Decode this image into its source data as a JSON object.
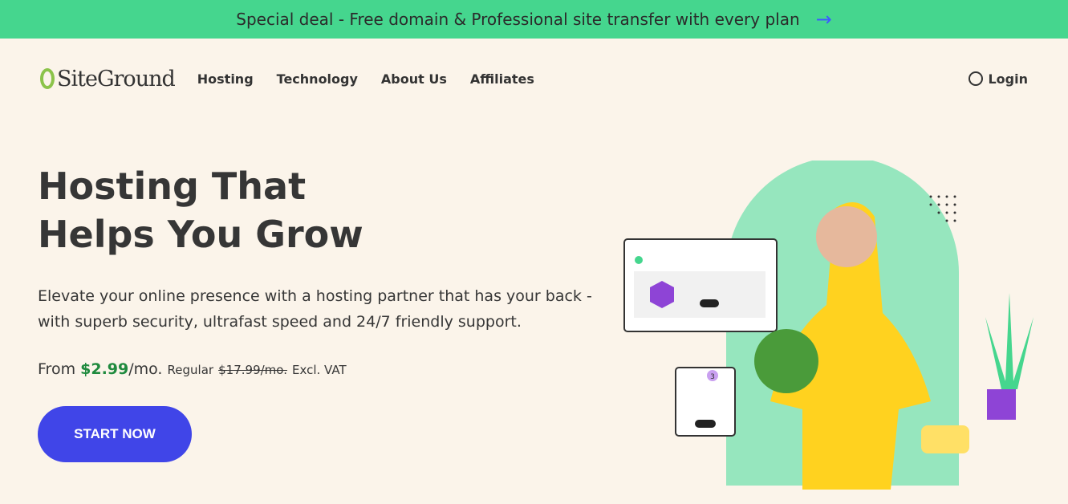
{
  "promo": {
    "text": "Special deal - Free domain & Professional site transfer with every plan",
    "arrow_icon": "arrow-right"
  },
  "nav": {
    "logo": "SiteGround",
    "items": [
      "Hosting",
      "Technology",
      "About Us",
      "Affiliates"
    ],
    "login": "Login"
  },
  "hero": {
    "title_line1": "Hosting That",
    "title_line2": "Helps You Grow",
    "subtitle": "Elevate your online presence with a hosting partner that has your back - with superb security, ultrafast speed and 24/7 friendly support.",
    "price_prefix": "From ",
    "price": "$2.99",
    "price_suffix": "/mo.",
    "regular_label": "Regular",
    "regular_price": "$17.99/mo.",
    "vat": "Excl. VAT",
    "cta": "START NOW",
    "badge_count": "3"
  },
  "colors": {
    "promo_bg": "#45d68e",
    "cta": "#4045e8",
    "price": "#1f8a3e",
    "background": "#fbf4ea"
  }
}
